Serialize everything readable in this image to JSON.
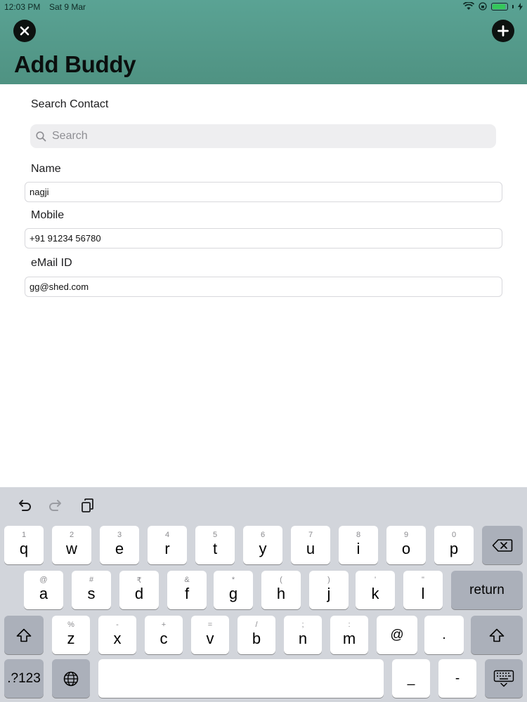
{
  "status_bar": {
    "time": "12:03 PM",
    "date": "Sat 9 Mar"
  },
  "header": {
    "title": "Add Buddy",
    "close_icon": "close-circle-icon",
    "add_icon": "plus-circle-icon"
  },
  "form": {
    "search_label": "Search Contact",
    "search_placeholder": "Search",
    "name_label": "Name",
    "name_value": "nagji",
    "mobile_label": "Mobile",
    "mobile_value": "+91 91234 56780",
    "email_label": "eMail ID",
    "email_prefix": "gg",
    "email_suffix": "@shed.com"
  },
  "keyboard": {
    "row1": [
      {
        "main": "q",
        "sub": "1"
      },
      {
        "main": "w",
        "sub": "2"
      },
      {
        "main": "e",
        "sub": "3"
      },
      {
        "main": "r",
        "sub": "4"
      },
      {
        "main": "t",
        "sub": "5"
      },
      {
        "main": "y",
        "sub": "6"
      },
      {
        "main": "u",
        "sub": "7"
      },
      {
        "main": "i",
        "sub": "8"
      },
      {
        "main": "o",
        "sub": "9"
      },
      {
        "main": "p",
        "sub": "0"
      }
    ],
    "row2": [
      {
        "main": "a",
        "sub": "@"
      },
      {
        "main": "s",
        "sub": "#"
      },
      {
        "main": "d",
        "sub": "₹"
      },
      {
        "main": "f",
        "sub": "&"
      },
      {
        "main": "g",
        "sub": "*"
      },
      {
        "main": "h",
        "sub": "("
      },
      {
        "main": "j",
        "sub": ")"
      },
      {
        "main": "k",
        "sub": "'"
      },
      {
        "main": "l",
        "sub": "\""
      }
    ],
    "row3": [
      {
        "main": "z",
        "sub": "%"
      },
      {
        "main": "x",
        "sub": "-"
      },
      {
        "main": "c",
        "sub": "+"
      },
      {
        "main": "v",
        "sub": "="
      },
      {
        "main": "b",
        "sub": "/"
      },
      {
        "main": "n",
        "sub": ";"
      },
      {
        "main": "m",
        "sub": ":"
      },
      {
        "main": "@",
        "sub": ""
      },
      {
        "main": ".",
        "sub": ""
      }
    ],
    "return_label": "return",
    "numbers_label": ".?123",
    "underscore_label": "_",
    "dash_label": "-"
  }
}
